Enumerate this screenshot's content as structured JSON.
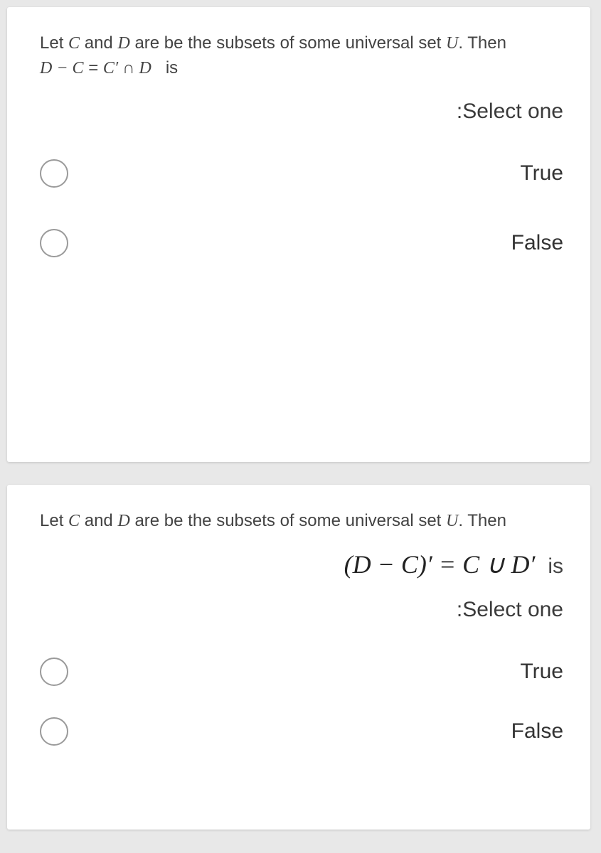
{
  "q1": {
    "text_pre": "Let ",
    "c": "C",
    "and": " and ",
    "d": "D",
    "text_mid": " are be the subsets of some universal set ",
    "u": "U",
    "then": ". Then",
    "eq_lhs": "D − C",
    "eq_eq": " = ",
    "eq_rhs": "C′ ∩ D",
    "is": "is",
    "select": ":Select one",
    "options": [
      "True",
      "False"
    ]
  },
  "q2": {
    "text_pre": "Let ",
    "c": "C",
    "and": " and ",
    "d": "D",
    "text_mid": " are be the subsets of some universal set ",
    "u": "U",
    "then": ". Then",
    "eq": "(D − C)′ = C ∪ D′",
    "is": "is",
    "select": ":Select one",
    "options": [
      "True",
      "False"
    ]
  }
}
